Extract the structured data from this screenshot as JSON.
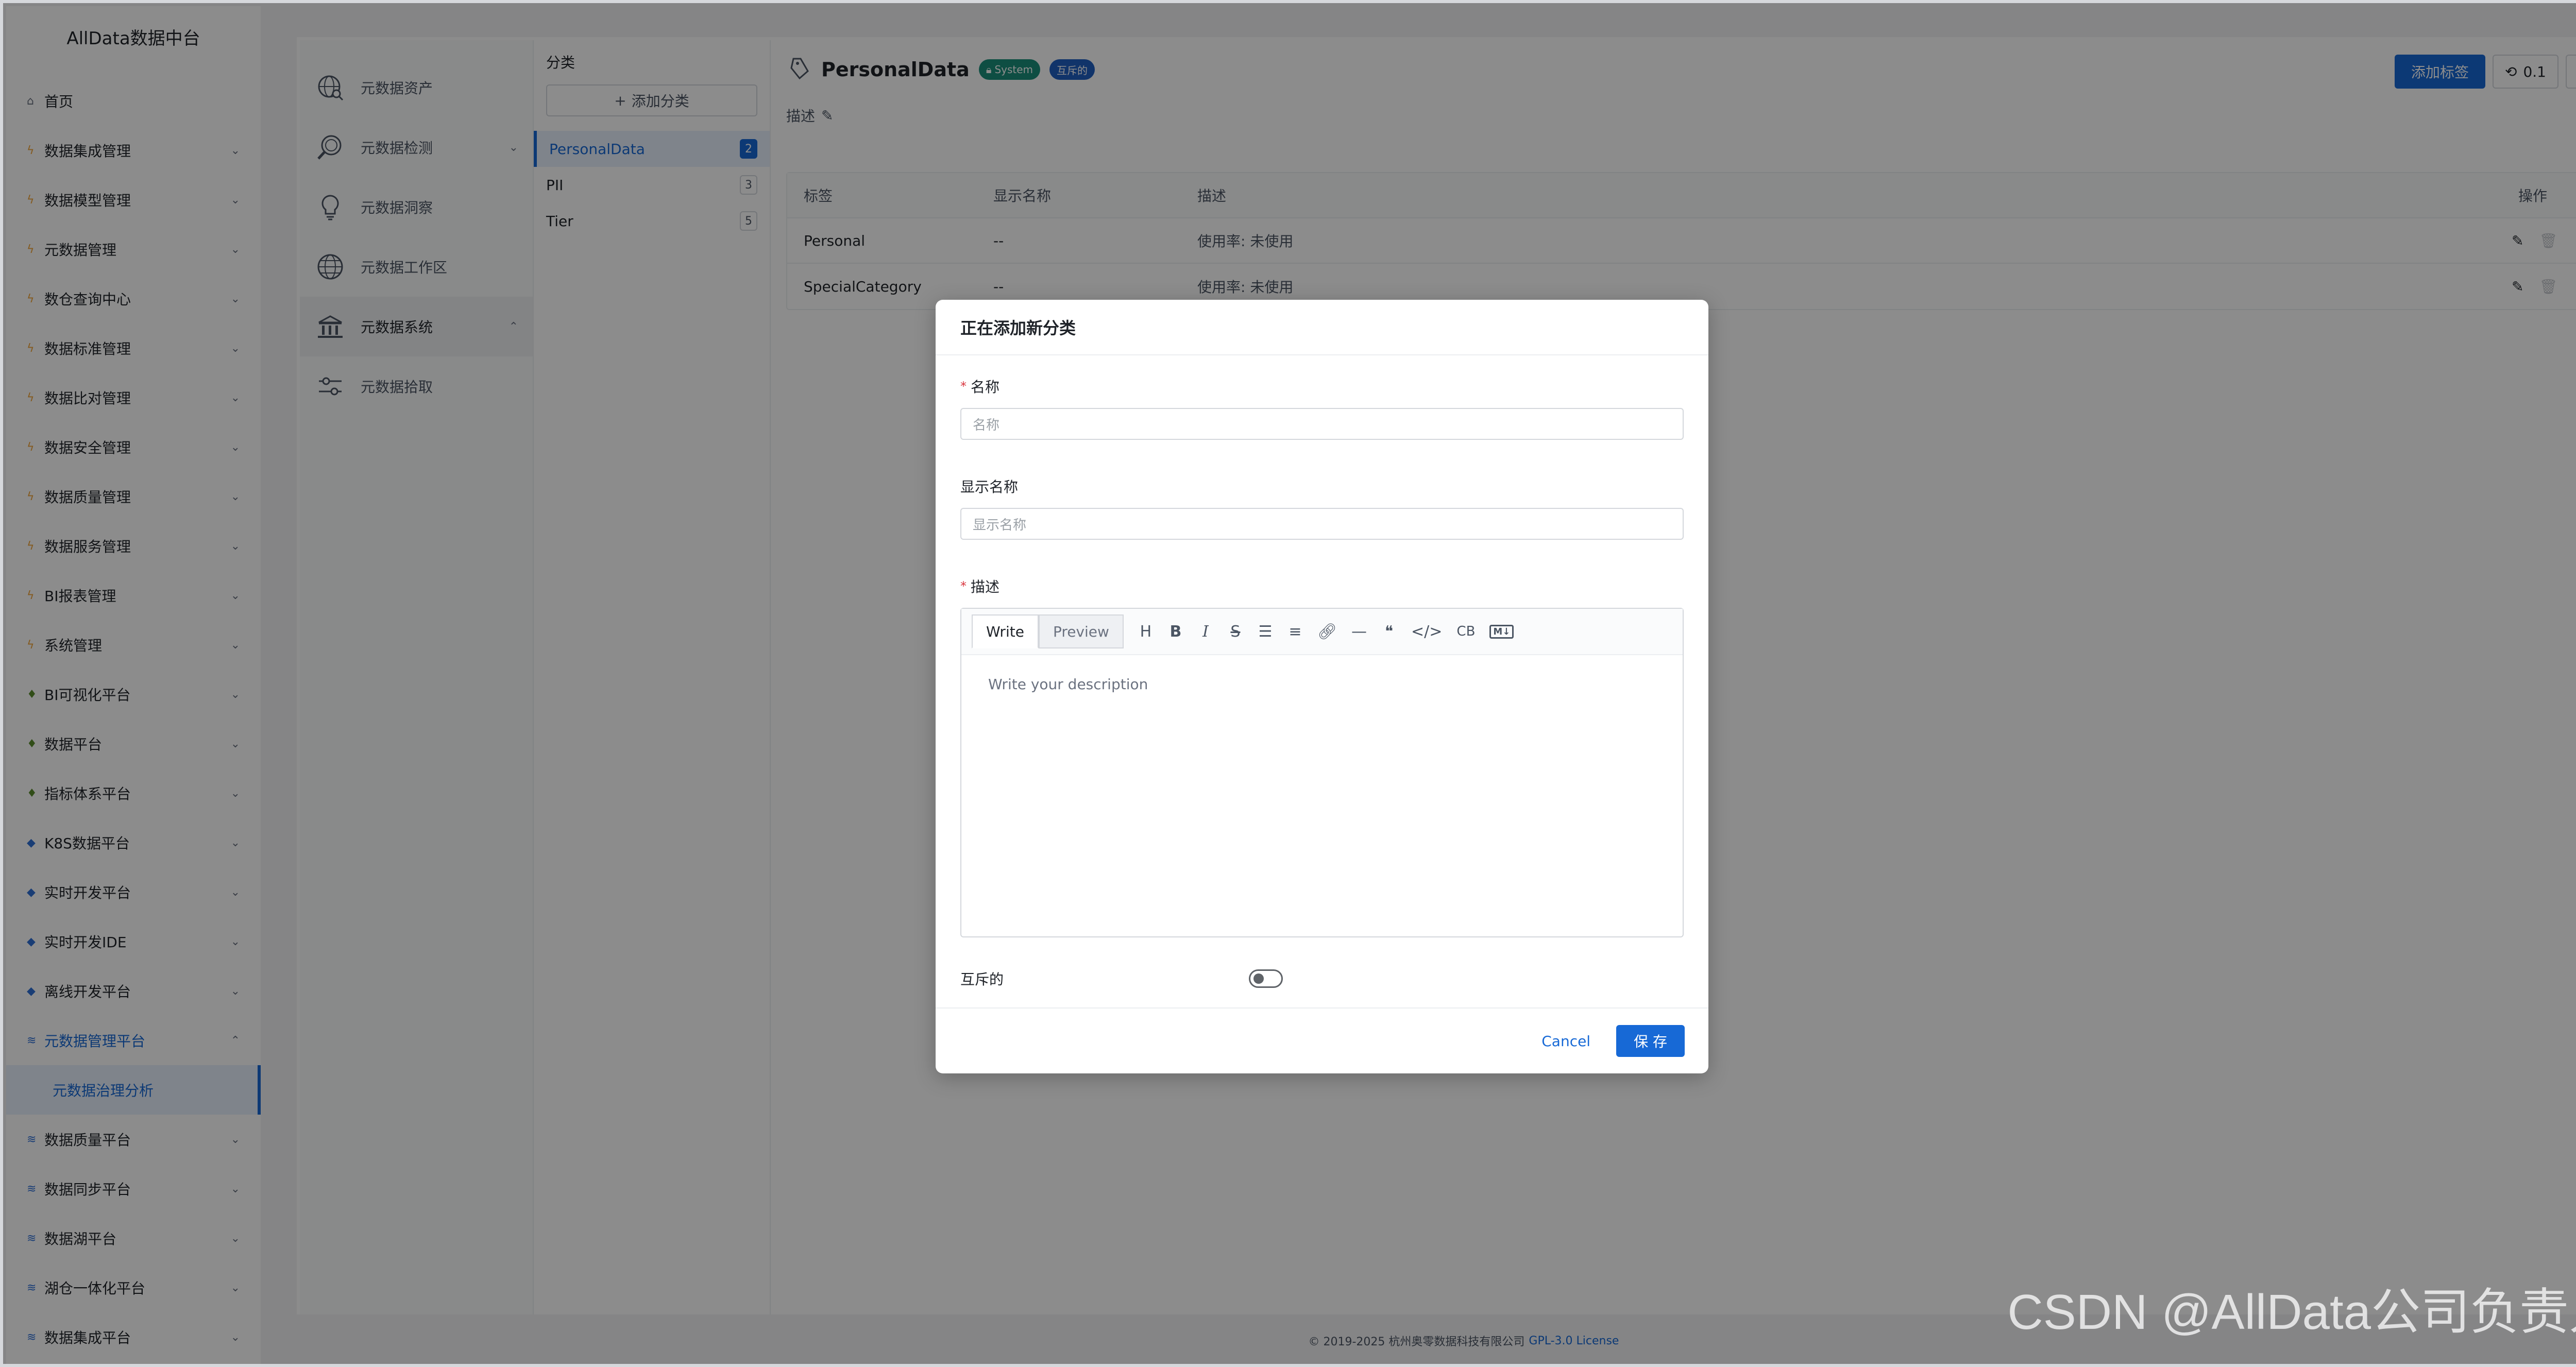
{
  "app": {
    "title": "AllData数据中台"
  },
  "sidebar": {
    "items": [
      {
        "label": "首页",
        "icon": "home-icon"
      },
      {
        "label": "数据集成管理",
        "icon": "bolt-icon"
      },
      {
        "label": "数据模型管理",
        "icon": "bolt-icon"
      },
      {
        "label": "元数据管理",
        "icon": "bolt-icon"
      },
      {
        "label": "数仓查询中心",
        "icon": "bolt-icon"
      },
      {
        "label": "数据标准管理",
        "icon": "bolt-icon"
      },
      {
        "label": "数据比对管理",
        "icon": "bolt-icon"
      },
      {
        "label": "数据安全管理",
        "icon": "bolt-icon"
      },
      {
        "label": "数据质量管理",
        "icon": "bolt-icon"
      },
      {
        "label": "数据服务管理",
        "icon": "bolt-icon"
      },
      {
        "label": "BI报表管理",
        "icon": "bolt-icon"
      },
      {
        "label": "系统管理",
        "icon": "bolt-icon"
      },
      {
        "label": "BI可视化平台",
        "icon": "flask-icon"
      },
      {
        "label": "数据平台",
        "icon": "flask-icon"
      },
      {
        "label": "指标体系平台",
        "icon": "flask-icon"
      },
      {
        "label": "K8S数据平台",
        "icon": "diamond-icon"
      },
      {
        "label": "实时开发平台",
        "icon": "diamond-icon"
      },
      {
        "label": "实时开发IDE",
        "icon": "diamond-icon"
      },
      {
        "label": "离线开发平台",
        "icon": "diamond-icon"
      },
      {
        "label": "元数据管理平台",
        "icon": "layers-icon"
      },
      {
        "label": "数据质量平台",
        "icon": "layers-icon"
      },
      {
        "label": "数据同步平台",
        "icon": "layers-icon"
      },
      {
        "label": "数据湖平台",
        "icon": "layers-icon"
      },
      {
        "label": "湖仓一体化平台",
        "icon": "layers-icon"
      },
      {
        "label": "数据集成平台",
        "icon": "layers-icon"
      }
    ],
    "active_sub": "元数据治理分析"
  },
  "menu2": {
    "items": [
      {
        "label": "元数据资产",
        "icon": "globe-search-icon"
      },
      {
        "label": "元数据检测",
        "icon": "magnifier-icon"
      },
      {
        "label": "元数据洞察",
        "icon": "bulb-icon"
      },
      {
        "label": "元数据工作区",
        "icon": "globe-icon"
      },
      {
        "label": "元数据系统",
        "icon": "bank-icon"
      },
      {
        "label": "元数据拾取",
        "icon": "sliders-icon"
      }
    ]
  },
  "categories": {
    "title": "分类",
    "add_label": "添加分类",
    "items": [
      {
        "name": "PersonalData",
        "count": "2"
      },
      {
        "name": "PII",
        "count": "3"
      },
      {
        "name": "Tier",
        "count": "5"
      }
    ]
  },
  "detail": {
    "title": "PersonalData",
    "badge_system": "System",
    "badge_mutual": "互斥的",
    "desc_label": "描述",
    "add_tag": "添加标签",
    "version": "0.1",
    "table": {
      "headers": [
        "标签",
        "显示名称",
        "描述",
        "操作"
      ],
      "rows": [
        {
          "tag": "Personal",
          "display": "--",
          "desc": "使用率: 未使用"
        },
        {
          "tag": "SpecialCategory",
          "display": "--",
          "desc": "使用率: 未使用"
        }
      ]
    }
  },
  "modal": {
    "title": "正在添加新分类",
    "name_label": "名称",
    "name_placeholder": "名称",
    "display_label": "显示名称",
    "display_placeholder": "显示名称",
    "desc_label": "描述",
    "tab_write": "Write",
    "tab_preview": "Preview",
    "tools": {
      "heading": "H",
      "bold": "B",
      "italic": "I",
      "strike": "S",
      "cb": "CB"
    },
    "editor_placeholder": "Write your description",
    "mutual_label": "互斥的",
    "mutual_on": false,
    "cancel": "Cancel",
    "save": "保 存"
  },
  "footer": {
    "copyright": "© 2019-2025 杭州奥零数据科技有限公司",
    "license": "GPL-3.0 License"
  },
  "watermark": "CSDN @AllData公司负责人",
  "colors": {
    "primary": "#1769d6",
    "system_badge": "#1a8f7a",
    "mutual_badge": "#1f5fc2"
  }
}
